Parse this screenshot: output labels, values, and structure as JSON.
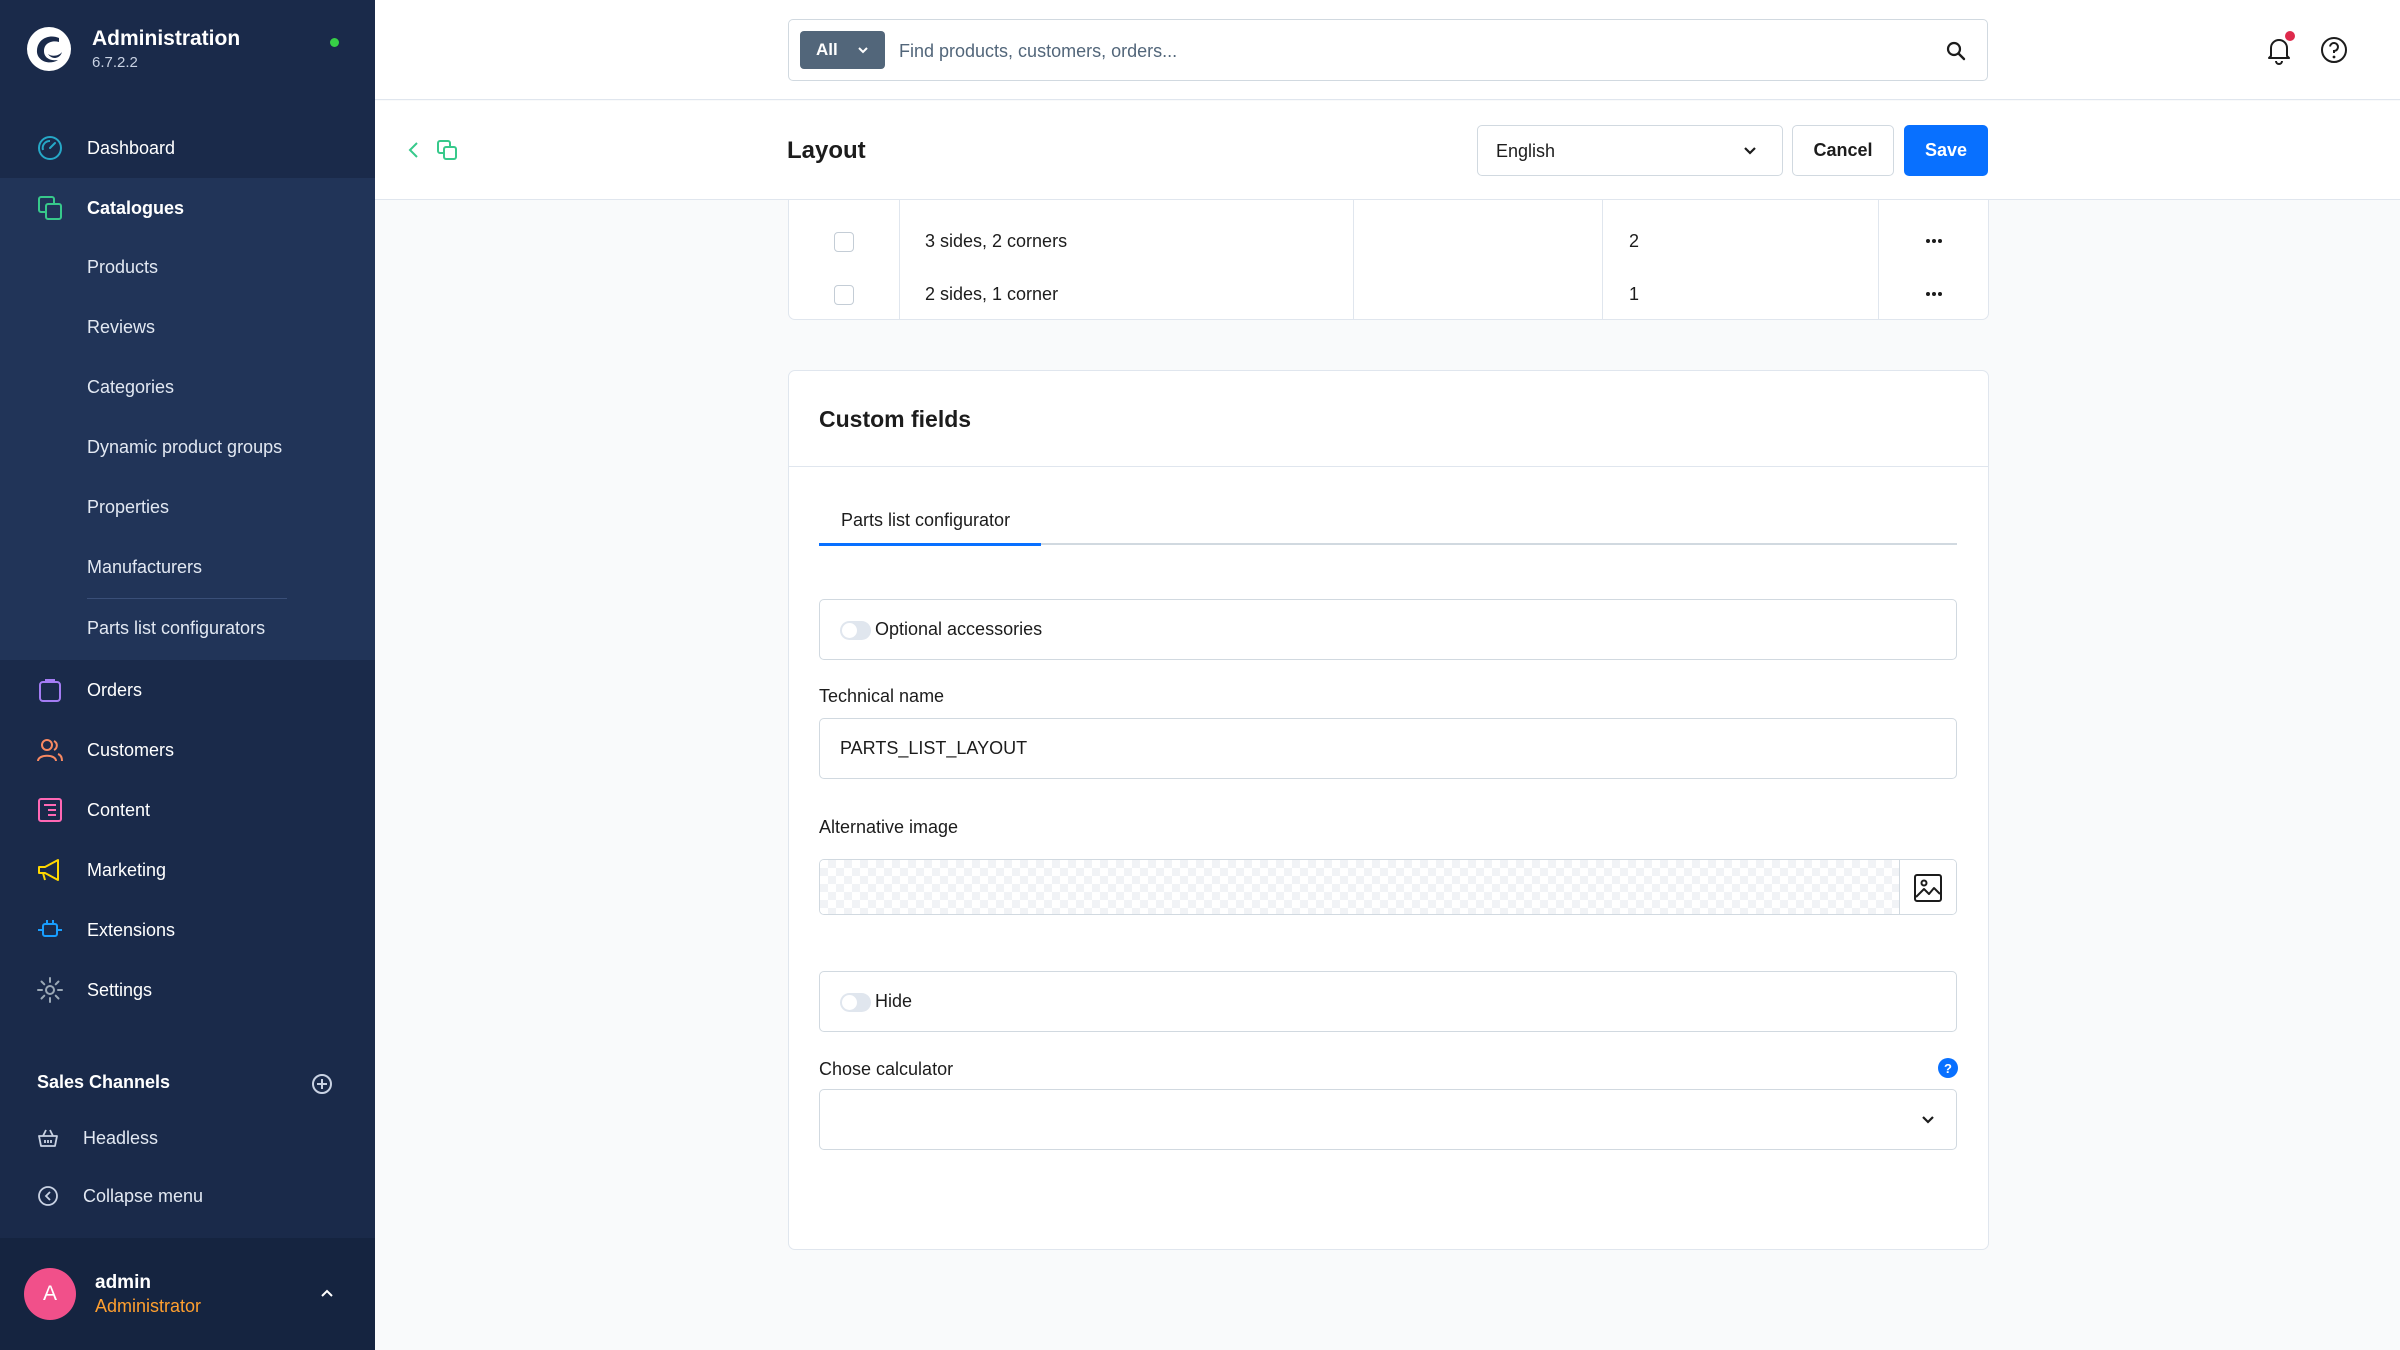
{
  "sidebar": {
    "brand_title": "Administration",
    "brand_version": "6.7.2.2",
    "nav": [
      {
        "label": "Dashboard",
        "icon": "dashboard-icon"
      },
      {
        "label": "Catalogues",
        "icon": "catalogues-icon"
      },
      {
        "label": "Orders",
        "icon": "orders-icon"
      },
      {
        "label": "Customers",
        "icon": "customers-icon"
      },
      {
        "label": "Content",
        "icon": "content-icon"
      },
      {
        "label": "Marketing",
        "icon": "marketing-icon"
      },
      {
        "label": "Extensions",
        "icon": "extensions-icon"
      },
      {
        "label": "Settings",
        "icon": "settings-icon"
      }
    ],
    "catalogue_items": [
      "Products",
      "Reviews",
      "Categories",
      "Dynamic product groups",
      "Properties",
      "Manufacturers",
      "Parts list configurators"
    ],
    "sales_channels_title": "Sales Channels",
    "sales_channels": [
      {
        "label": "Headless",
        "icon": "basket-icon"
      },
      {
        "label": "Collapse menu",
        "icon": "collapse-icon"
      }
    ],
    "user": {
      "initial": "A",
      "name": "admin",
      "role": "Administrator"
    }
  },
  "topbar": {
    "search_type": "All",
    "search_placeholder": "Find products, customers, orders..."
  },
  "smartbar": {
    "title": "Layout",
    "language": "English",
    "cancel_label": "Cancel",
    "save_label": "Save"
  },
  "table": {
    "rows": [
      {
        "name": "3 sides, 2 corners",
        "value": "2"
      },
      {
        "name": "2 sides, 1 corner",
        "value": "1"
      }
    ]
  },
  "custom_fields": {
    "title": "Custom fields",
    "tab": "Parts list configurator",
    "optional_accessories_label": "Optional accessories",
    "technical_name_label": "Technical name",
    "technical_name_value": "PARTS_LIST_LAYOUT",
    "alternative_image_label": "Alternative image",
    "hide_label": "Hide",
    "calculator_label": "Chose calculator",
    "help_glyph": "?"
  },
  "colors": {
    "sidebar_bg": "#1a2a4a",
    "accent": "#0870ff",
    "user_role": "#ff9f2f",
    "avatar": "#f1508a",
    "online_dot": "#37d046",
    "notification_dot": "#de294c"
  }
}
